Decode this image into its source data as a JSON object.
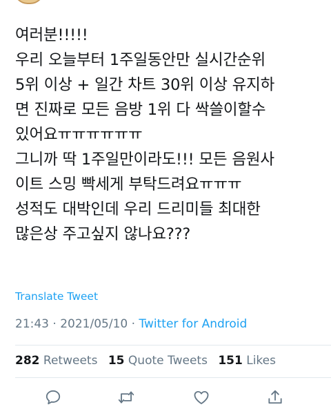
{
  "tweet": {
    "lines": [
      "여러분!!!!!",
      "우리 오늘부터 1주일동안만 실시간순위",
      "5위 이상 + 일간 차트 30위 이상 유지하",
      "면 진짜로 모든 음방 1위 다 싹쓸이할수",
      "있어요ㅠㅠㅠㅠㅠㅠ",
      "그니까 딱 1주일만이라도!!! 모든 음원사",
      "이트 스밍 빡세게 부탁드려요ㅠㅠㅠ",
      "성적도 대박인데 우리 드리미들 최대한",
      "많은상 주고싶지 않나요???"
    ],
    "translate_label": "Translate Tweet",
    "time": "21:43",
    "separator": " · ",
    "date": "2021/05/10",
    "source": "Twitter for Android"
  },
  "stats": {
    "retweets_count": "282",
    "retweets_label": "Retweets",
    "quote_count": "15",
    "quote_label": "Quote Tweets",
    "likes_count": "151",
    "likes_label": "Likes"
  },
  "actions": {
    "reply_icon": "reply-icon",
    "retweet_icon": "retweet-icon",
    "like_icon": "heart-icon",
    "share_icon": "share-icon"
  },
  "colors": {
    "text": "#14171a",
    "secondary": "#657786",
    "link": "#1da1f2",
    "divider": "#e1e8ed"
  }
}
